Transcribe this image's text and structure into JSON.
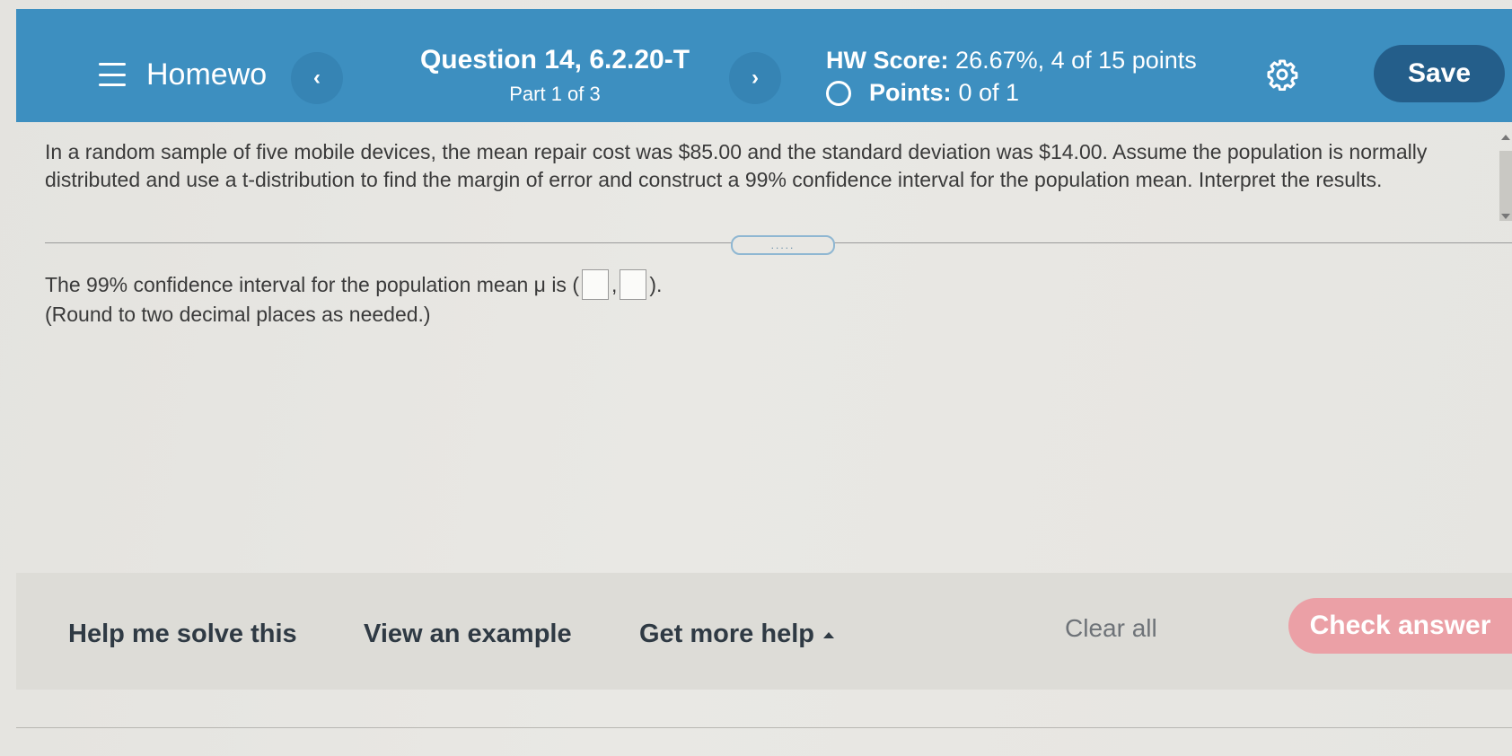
{
  "header": {
    "title": "Homewo",
    "prev_icon": "‹",
    "next_icon": "›",
    "question_title": "Question 14, 6.2.20-T",
    "question_part": "Part 1 of 3",
    "hw_score_label": "HW Score:",
    "hw_score_value": "26.67%, 4 of 15 points",
    "points_label": "Points:",
    "points_value": "0 of 1",
    "save_label": "Save",
    "accent_color": "#3d8fc0"
  },
  "question": {
    "problem_text": "In a random sample of five mobile devices, the mean repair cost was $85.00 and the standard deviation was $14.00. Assume the population is normally distributed and use a t-distribution to find the margin of error and construct a 99% confidence interval for the population mean. Interpret the results.",
    "divider_handle": ".....",
    "answer_prefix": "The 99% confidence interval for the population mean μ is (",
    "answer_separator": ",",
    "answer_suffix": ").",
    "answer_lower": "",
    "answer_upper": "",
    "round_note": "(Round to two decimal places as needed.)"
  },
  "footer": {
    "help_solve": "Help me solve this",
    "view_example": "View an example",
    "more_help": "Get more help",
    "clear_all": "Clear all",
    "check_answer": "Check answer",
    "check_answer_color": "#eba0a6"
  }
}
